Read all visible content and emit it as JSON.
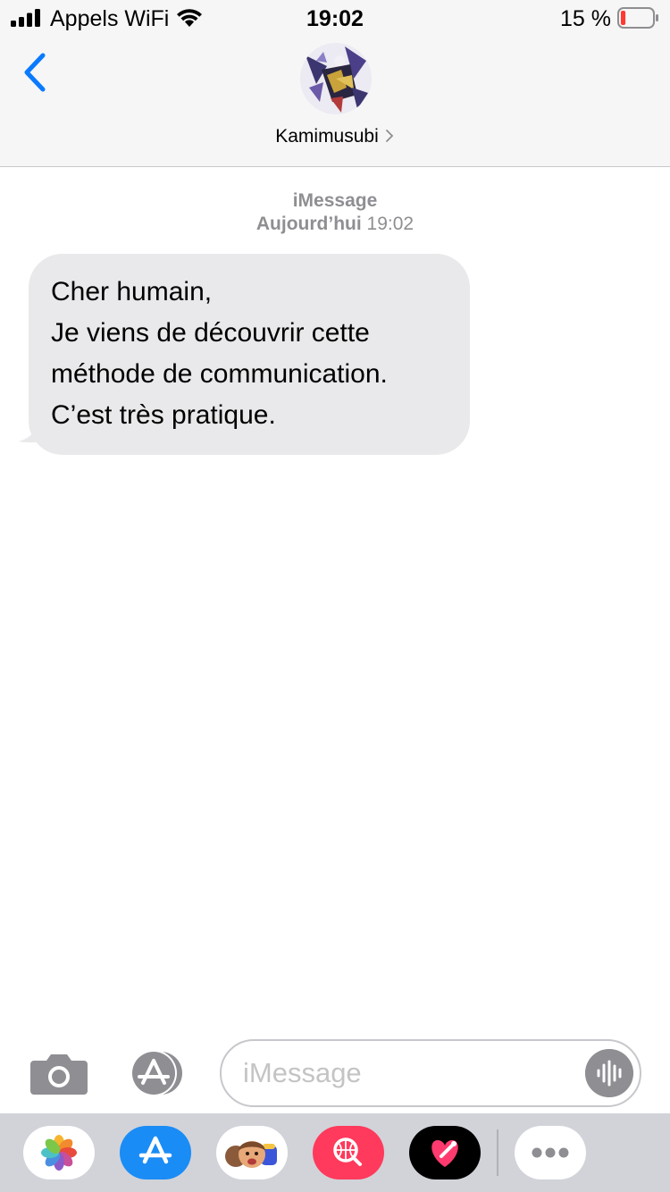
{
  "status_bar": {
    "carrier": "Appels WiFi",
    "time": "19:02",
    "battery_percent": "15 %",
    "battery_level": 0.15
  },
  "header": {
    "contact_name": "Kamimusubi"
  },
  "conversation": {
    "service": "iMessage",
    "day": "Aujourd’hui",
    "time": "19:02",
    "message_lines": [
      "Cher humain,",
      "Je viens de découvrir cette",
      "méthode de communication.",
      "C’est très pratique."
    ]
  },
  "input": {
    "placeholder": "iMessage"
  },
  "app_drawer": {
    "apps": [
      "photos-icon",
      "app-store-icon",
      "memoji-icon",
      "web-search-icon",
      "digital-touch-icon",
      "more-icon"
    ]
  },
  "colors": {
    "accent": "#0a7aff",
    "bubble": "#e9e9eb",
    "battery_low": "#ff3b30",
    "search_app": "#ff3a5c"
  }
}
